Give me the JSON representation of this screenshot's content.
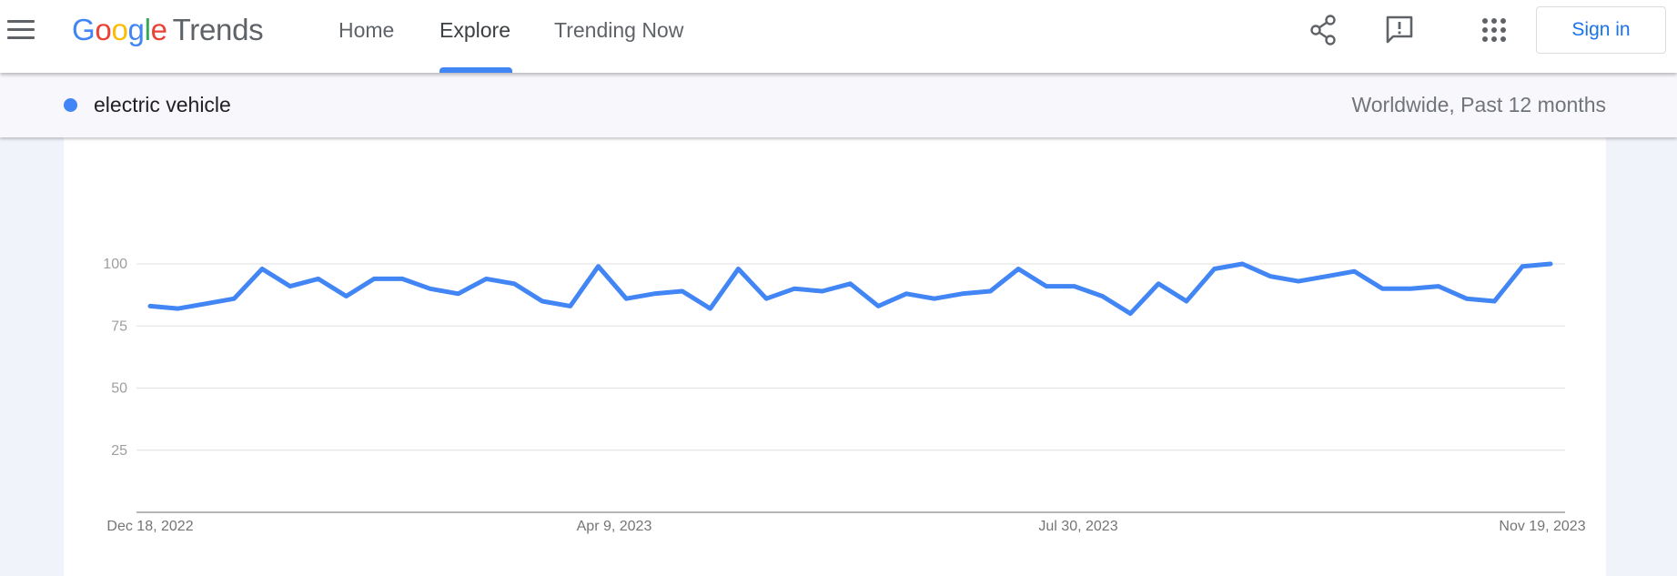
{
  "header": {
    "logo": {
      "google_letters": [
        "G",
        "o",
        "o",
        "g",
        "l",
        "e"
      ],
      "product": "Trends"
    },
    "tabs": [
      {
        "label": "Home",
        "active": false
      },
      {
        "label": "Explore",
        "active": true
      },
      {
        "label": "Trending Now",
        "active": false
      }
    ],
    "icons": [
      "menu-icon",
      "share-icon",
      "feedback-icon",
      "apps-icon"
    ],
    "sign_in_label": "Sign in"
  },
  "comparison": {
    "term": "electric vehicle",
    "term_color": "#4285f4",
    "scope": "Worldwide, Past 12 months"
  },
  "chart_data": {
    "type": "line",
    "ylim": [
      0,
      100
    ],
    "yticks": [
      25,
      50,
      75,
      100
    ],
    "xtick_labels": [
      "Dec 18, 2022",
      "Apr 9, 2023",
      "Jul 30, 2023",
      "Nov 19, 2023"
    ],
    "grid": true,
    "series": [
      {
        "color": "#4285f4",
        "values": [
          83,
          82,
          84,
          86,
          98,
          91,
          94,
          87,
          94,
          94,
          90,
          88,
          94,
          92,
          85,
          83,
          99,
          86,
          88,
          89,
          82,
          98,
          86,
          90,
          89,
          92,
          83,
          88,
          86,
          88,
          89,
          98,
          91,
          91,
          87,
          80,
          92,
          85,
          98,
          100,
          95,
          93,
          95,
          97,
          90,
          90,
          91,
          86,
          85,
          99,
          100
        ]
      }
    ]
  }
}
